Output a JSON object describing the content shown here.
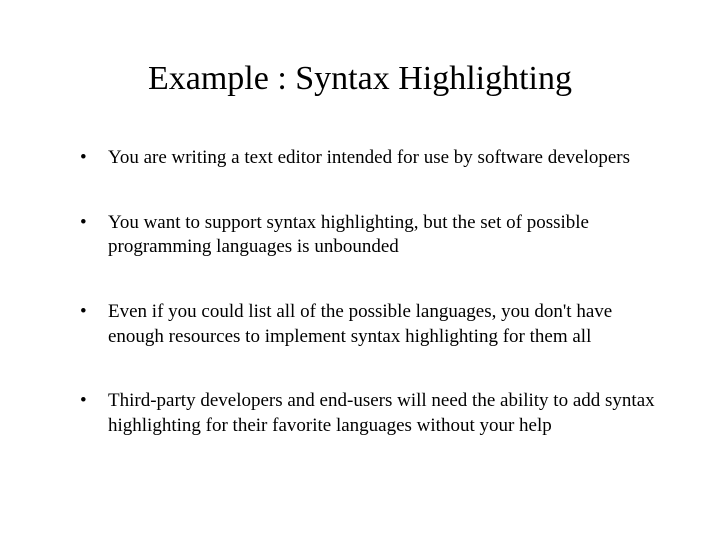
{
  "slide": {
    "title": "Example : Syntax Highlighting",
    "bullets": [
      "You are writing a text editor intended for use by software developers",
      "You want to support syntax highlighting, but the set of possible programming languages is unbounded",
      "Even if you could list all of the possible languages, you don't have enough resources to implement syntax highlighting for them all",
      "Third-party developers and end-users will need the ability to add syntax highlighting for their favorite languages without your help"
    ]
  }
}
